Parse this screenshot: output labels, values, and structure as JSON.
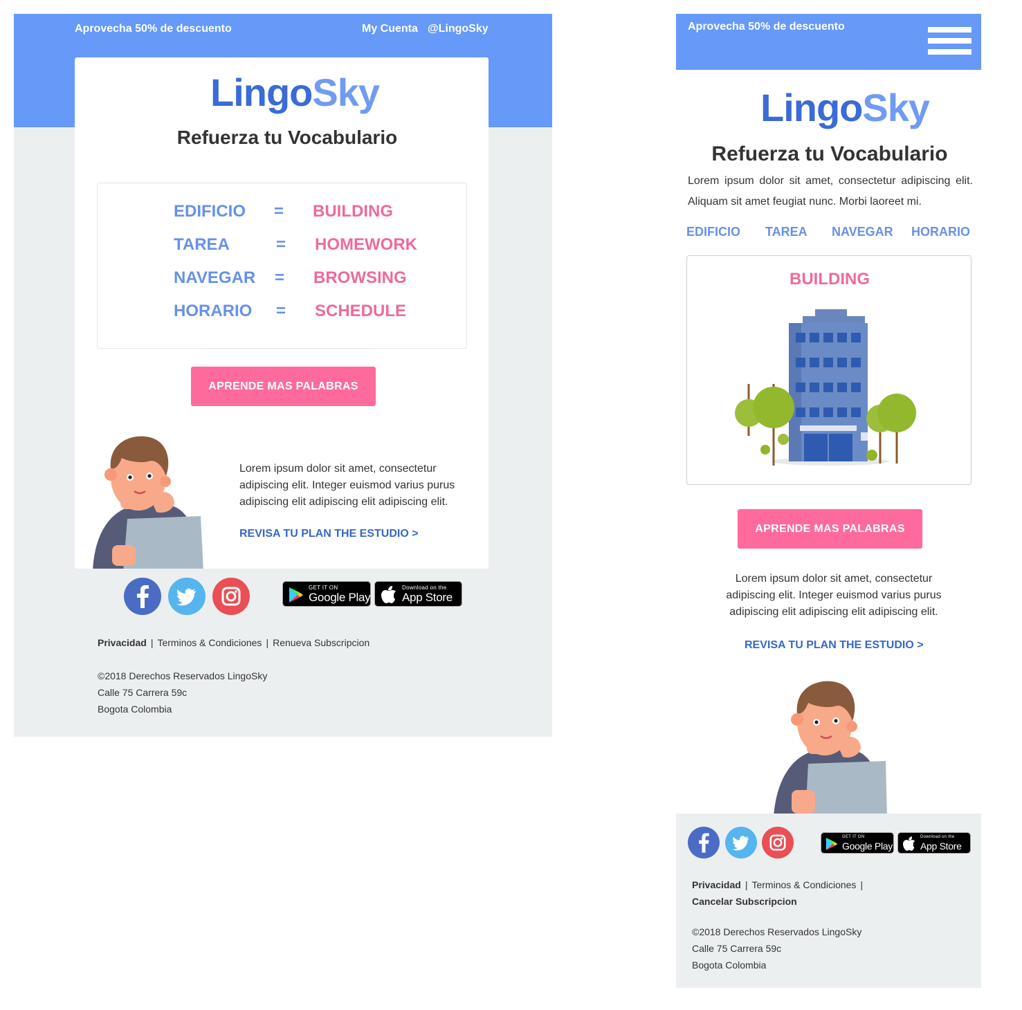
{
  "colors": {
    "brand_blue": "#6699f8",
    "logo_dark_blue": "#3a6bd6",
    "logo_light_blue": "#6f9bf3",
    "word_blue": "#6691e8",
    "word_pink": "#ee6a9b",
    "cta_pink": "#fd6a9b",
    "link_blue": "#3567c9",
    "footer_gray": "#eceff0"
  },
  "desktop": {
    "header": {
      "promo": "Aprovecha 50% de descuento",
      "account": "My Cuenta",
      "handle": "@LingoSky"
    },
    "logo": {
      "part1": "Lingo",
      "part2": "Sky"
    },
    "title": "Refuerza tu Vocabulario",
    "vocab": [
      {
        "es": "EDIFICIO",
        "eq": "=",
        "en": "BUILDING"
      },
      {
        "es": "TAREA",
        "eq": "=",
        "en": "HOMEWORK"
      },
      {
        "es": "NAVEGAR",
        "eq": "=",
        "en": "BROWSING"
      },
      {
        "es": "HORARIO",
        "eq": "=",
        "en": "SCHEDULE"
      }
    ],
    "cta": "APRENDE MAS PALABRAS",
    "body": "Lorem ipsum dolor sit amet, consectetur adipiscing elit. Integer euismod varius purus adipiscing elit adipiscing elit adipiscing elit.",
    "plan_link": "REVISA TU PLAN THE ESTUDIO >",
    "footer": {
      "links": [
        "Privacidad",
        "Terminos & Condiciones",
        "Renueva Subscripcion"
      ],
      "separator": "|",
      "copyright": "©2018 Derechos Reservados LingoSky",
      "address1": "Calle 75 Carrera 59c",
      "address2": "Bogota Colombia"
    }
  },
  "mobile": {
    "header": {
      "promo": "Aprovecha 50% de descuento",
      "menu_icon": "hamburger-icon"
    },
    "logo": {
      "part1": "Lingo",
      "part2": "Sky"
    },
    "title": "Refuerza tu Vocabulario",
    "intro": "Lorem ipsum dolor sit amet, consectetur adipiscing elit. Aliquam sit amet feugiat nunc. Morbi laoreet mi.",
    "tabs": [
      "EDIFICIO",
      "TAREA",
      "NAVEGAR",
      "HORARIO"
    ],
    "word": "BUILDING",
    "cta": "APRENDE MAS PALABRAS",
    "body": "Lorem ipsum dolor sit amet, consectetur adipiscing elit. Integer euismod varius purus adipiscing elit adipiscing elit adipiscing elit.",
    "plan_link": "REVISA TU PLAN THE ESTUDIO >",
    "footer": {
      "links": [
        "Privacidad",
        "Terminos & Condiciones",
        "Cancelar Subscripcion"
      ],
      "separator": "|",
      "copyright": "©2018 Derechos Reservados LingoSky",
      "address1": "Calle 75 Carrera 59c",
      "address2": "Bogota Colombia"
    }
  },
  "social": {
    "icons": [
      "facebook-icon",
      "twitter-icon",
      "instagram-icon"
    ],
    "facebook_color": "#4a6cc4",
    "twitter_color": "#56b4ef",
    "instagram_color": "#e94f55"
  },
  "stores": {
    "google_small": "GET IT ON",
    "google_big": "Google Play",
    "apple_small": "Download on the",
    "apple_big": "App Store"
  }
}
